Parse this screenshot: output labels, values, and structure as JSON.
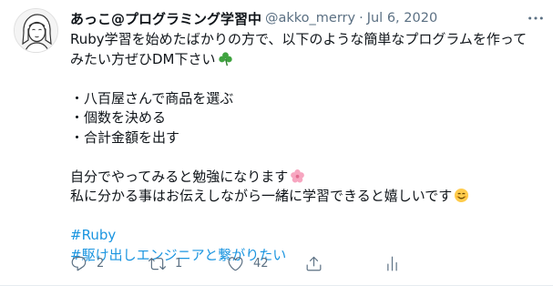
{
  "tweet": {
    "author": {
      "name": "あっこ@プログラミング学習中",
      "handle": "@akko_merry",
      "separator": "·",
      "date": "Jul 6, 2020"
    },
    "more_icon": "more-options-icon",
    "lines": [
      "Ruby学習を始めたばかりの方で、以下のような簡単なプログラムを作って",
      "みたい方ぜひDM下さい",
      "",
      "・八百屋さんで商品を選ぶ",
      "・個数を決める",
      "・合計金額を出す",
      "",
      "自分でやってみると勉強になります",
      "私に分かる事はお伝えしながら一緒に学習できると嬉しいです",
      ""
    ],
    "hashtags": [
      "#Ruby",
      "#駆け出しエンジニアと繋がりたい"
    ],
    "emoji_icons": [
      "shamrock-icon",
      "cherry-blossom-icon",
      "smiling-face-icon"
    ],
    "actions": {
      "reply_count": "2",
      "retweet_count": "1",
      "like_count": "42",
      "share_icon": "share-icon",
      "analytics_icon": "analytics-icon"
    },
    "colors": {
      "text": "#0f1419",
      "secondary": "#5b7083",
      "hashtag": "#1b95e0"
    }
  }
}
